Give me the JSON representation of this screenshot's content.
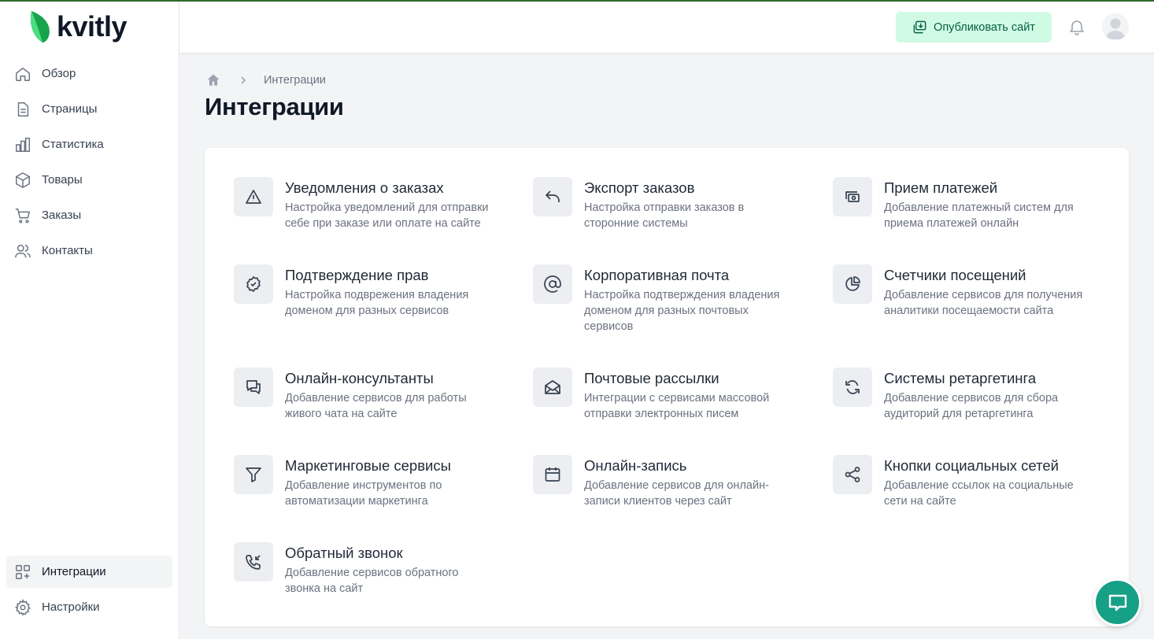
{
  "brand": {
    "name": "kvitly",
    "accent": "#10b981"
  },
  "sidebar": {
    "items": [
      {
        "label": "Обзор",
        "icon": "home-icon"
      },
      {
        "label": "Страницы",
        "icon": "document-icon"
      },
      {
        "label": "Статистика",
        "icon": "chart-bar-icon"
      },
      {
        "label": "Товары",
        "icon": "cube-icon"
      },
      {
        "label": "Заказы",
        "icon": "cart-icon"
      },
      {
        "label": "Контакты",
        "icon": "users-icon"
      }
    ],
    "bottom_items": [
      {
        "label": "Интеграции",
        "icon": "grid-plus-icon",
        "active": true
      },
      {
        "label": "Настройки",
        "icon": "gear-icon"
      }
    ]
  },
  "header": {
    "publish_label": "Опубликовать сайт"
  },
  "breadcrumb": {
    "current": "Интеграции"
  },
  "page": {
    "title": "Интеграции"
  },
  "integrations": [
    {
      "title": "Уведомления о заказах",
      "desc": [
        "Настройка уведомлений для отправки",
        "себе при заказе или оплате на сайте"
      ],
      "icon": "warning-triangle-icon"
    },
    {
      "title": "Экспорт заказов",
      "desc": [
        "Настройка отправки заказов в",
        "сторонние системы"
      ],
      "icon": "reply-arrow-icon"
    },
    {
      "title": "Прием платежей",
      "desc": [
        "Добавление платежный систем для",
        "приема платежей онлайн"
      ],
      "icon": "cash-icon"
    },
    {
      "title": "Подтверждение прав",
      "desc": [
        "Настройка подврежения владения",
        "доменом для разных сервисов"
      ],
      "icon": "badge-check-icon"
    },
    {
      "title": "Корпоративная почта",
      "desc": [
        "Настройка подтверждения владения",
        "доменом для разных почтовых",
        "сервисов"
      ],
      "icon": "at-sign-icon"
    },
    {
      "title": "Счетчики посещений",
      "desc": [
        "Добавление сервисов для получения",
        "аналитики посещаемости сайта"
      ],
      "icon": "pie-chart-icon"
    },
    {
      "title": "Онлайн-консультанты",
      "desc": [
        "Добавление сервисов для работы",
        "живого чата на сайте"
      ],
      "icon": "chat-bubbles-icon"
    },
    {
      "title": "Почтовые рассылки",
      "desc": [
        "Интеграции с сервисами массовой",
        "отправки электронных писем"
      ],
      "icon": "mail-open-icon"
    },
    {
      "title": "Системы ретаргетинга",
      "desc": [
        "Добавление сервисов для сбора",
        "аудиторий для ретаргетинга"
      ],
      "icon": "refresh-icon"
    },
    {
      "title": "Маркетинговые сервисы",
      "desc": [
        "Добавление инструментов по",
        "автоматизации маркетинга"
      ],
      "icon": "filter-funnel-icon"
    },
    {
      "title": "Онлайн-запись",
      "desc": [
        "Добавление сервисов для онлайн-",
        "записи клиентов через сайт"
      ],
      "icon": "calendar-icon"
    },
    {
      "title": "Кнопки социальных сетей",
      "desc": [
        "Добавление ссылок на социальные",
        "сети на сайте"
      ],
      "icon": "share-icon"
    },
    {
      "title": "Обратный звонок",
      "desc": [
        "Добавление сервисов обратного",
        "звонка на сайт"
      ],
      "icon": "phone-incoming-icon"
    }
  ]
}
